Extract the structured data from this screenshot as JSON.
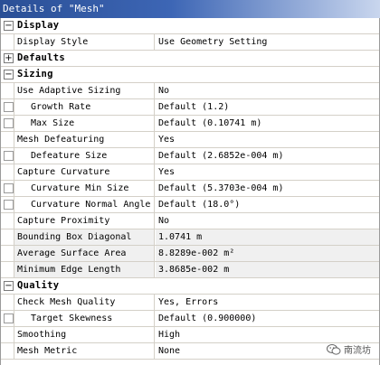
{
  "title": "Details of \"Mesh\"",
  "categories": {
    "display": "Display",
    "defaults": "Defaults",
    "sizing": "Sizing",
    "quality": "Quality"
  },
  "display": {
    "display_style": {
      "name": "Display Style",
      "value": "Use Geometry Setting"
    }
  },
  "sizing": {
    "use_adaptive_sizing": {
      "name": "Use Adaptive Sizing",
      "value": "No"
    },
    "growth_rate": {
      "name": "Growth Rate",
      "value": "Default (1.2)"
    },
    "max_size": {
      "name": "Max Size",
      "value": "Default (0.10741 m)"
    },
    "mesh_defeaturing": {
      "name": "Mesh Defeaturing",
      "value": "Yes"
    },
    "defeature_size": {
      "name": "Defeature Size",
      "value": "Default (2.6852e-004 m)"
    },
    "capture_curvature": {
      "name": "Capture Curvature",
      "value": "Yes"
    },
    "curvature_min_size": {
      "name": "Curvature Min Size",
      "value": "Default (5.3703e-004 m)"
    },
    "curvature_normal_angle": {
      "name": "Curvature Normal Angle",
      "value": "Default (18.0°)"
    },
    "capture_proximity": {
      "name": "Capture Proximity",
      "value": "No"
    },
    "bounding_box_diagonal": {
      "name": "Bounding Box Diagonal",
      "value": "1.0741 m"
    },
    "average_surface_area": {
      "name": "Average Surface Area",
      "value": "8.8289e-002 m²"
    },
    "minimum_edge_length": {
      "name": "Minimum Edge Length",
      "value": "3.8685e-002 m"
    }
  },
  "quality": {
    "check_mesh_quality": {
      "name": "Check Mesh Quality",
      "value": "Yes, Errors"
    },
    "target_skewness": {
      "name": "Target Skewness",
      "value": "Default (0.900000)"
    },
    "smoothing": {
      "name": "Smoothing",
      "value": "High"
    },
    "mesh_metric": {
      "name": "Mesh Metric",
      "value": "None"
    }
  },
  "icons": {
    "collapse": "minus-box-icon",
    "expand": "plus-box-icon",
    "checkbox": "checkbox-icon",
    "watermark": "wechat-logo-icon"
  },
  "watermark_text": "南流坊"
}
